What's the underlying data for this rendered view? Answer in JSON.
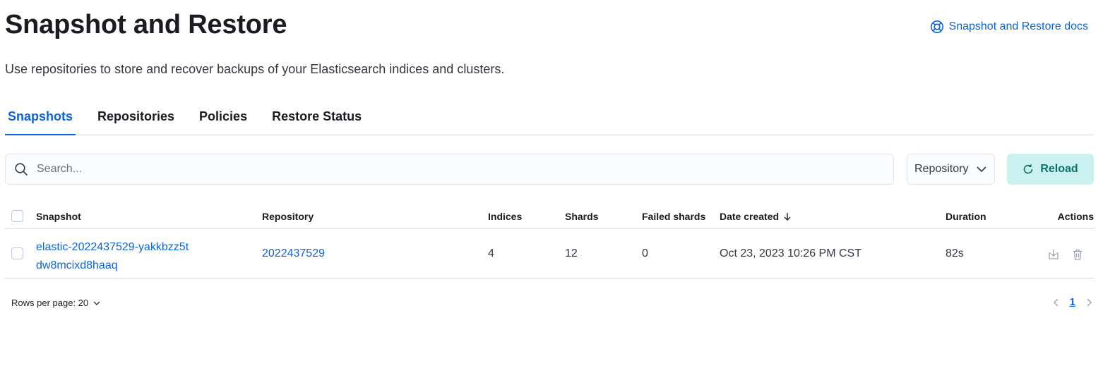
{
  "header": {
    "title": "Snapshot and Restore",
    "docs_link": "Snapshot and Restore docs",
    "description": "Use repositories to store and recover backups of your Elasticsearch indices and clusters."
  },
  "tabs": [
    {
      "label": "Snapshots",
      "selected": true
    },
    {
      "label": "Repositories",
      "selected": false
    },
    {
      "label": "Policies",
      "selected": false
    },
    {
      "label": "Restore Status",
      "selected": false
    }
  ],
  "toolbar": {
    "search_placeholder": "Search...",
    "repository_filter": "Repository",
    "reload_label": "Reload"
  },
  "table": {
    "columns": {
      "snapshot": "Snapshot",
      "repository": "Repository",
      "indices": "Indices",
      "shards": "Shards",
      "failed_shards": "Failed shards",
      "date_created": "Date created",
      "duration": "Duration",
      "actions": "Actions"
    },
    "rows": [
      {
        "snapshot": "elastic-2022437529-yakkbzz5tdw8mcixd8haaq",
        "repository": "2022437529",
        "indices": "4",
        "shards": "12",
        "failed_shards": "0",
        "date_created": "Oct 23, 2023 10:26 PM CST",
        "duration": "82s"
      }
    ]
  },
  "footer": {
    "rows_per_page": "Rows per page: 20",
    "current_page": "1"
  },
  "colors": {
    "accent": "#0b64dd",
    "reload_bg": "#caf1ef",
    "reload_text": "#07746b"
  },
  "icons": [
    "help-ring-icon",
    "search-icon",
    "chevron-down-icon",
    "refresh-icon",
    "sort-down-arrow-icon",
    "restore-icon",
    "trash-icon",
    "chevron-left-icon",
    "chevron-right-icon"
  ]
}
